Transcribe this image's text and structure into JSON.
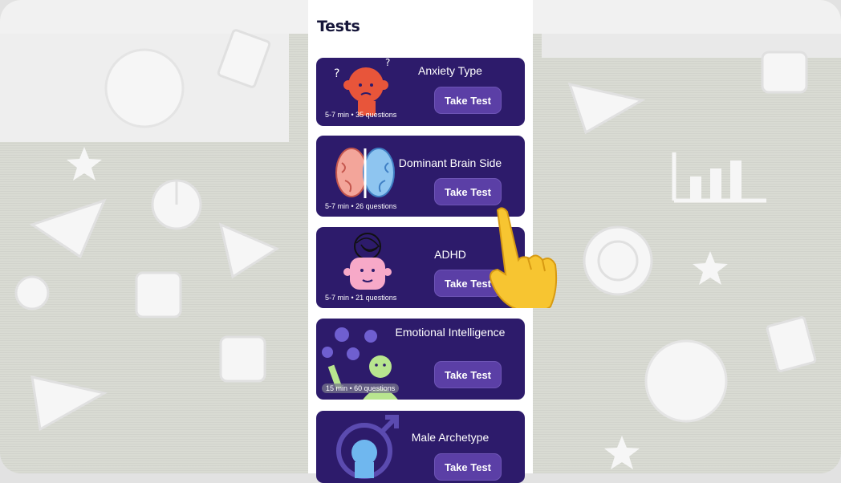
{
  "page": {
    "title": "Tests"
  },
  "tests": [
    {
      "name": "Anxiety Type",
      "button": "Take Test",
      "meta": "5-7 min • 35 questions"
    },
    {
      "name": "Dominant Brain Side",
      "button": "Take Test",
      "meta": "5-7 min • 26 questions"
    },
    {
      "name": "ADHD",
      "button": "Take Test",
      "meta": "5-7 min • 21 questions"
    },
    {
      "name": "Emotional Intelligence",
      "button": "Take Test",
      "meta": "15 min • 60 questions"
    },
    {
      "name": "Male Archetype",
      "button": "Take Test",
      "meta": ""
    }
  ],
  "colors": {
    "card": "#2d1b6b",
    "button": "#5b3fa6",
    "title": "#16163a"
  },
  "icons": [
    "pointing-hand-icon",
    "brain-icon",
    "anxious-face-icon",
    "messy-thoughts-icon",
    "emotions-icon",
    "male-symbol-icon"
  ]
}
